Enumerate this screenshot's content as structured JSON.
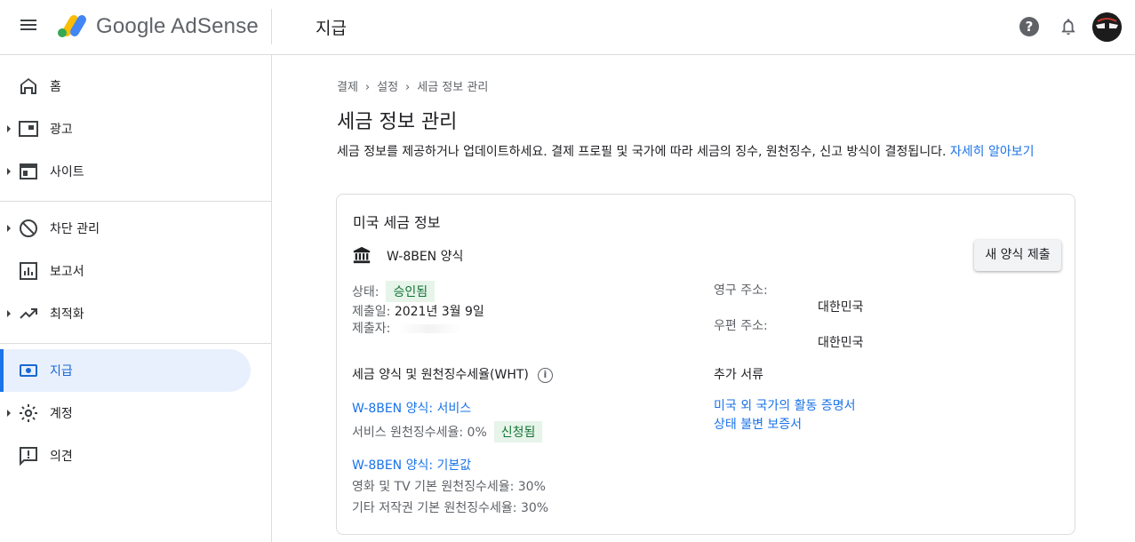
{
  "app": {
    "brand": "Google AdSense",
    "page_header": "지급"
  },
  "header": {
    "help_label": "?"
  },
  "sidebar": {
    "items": [
      {
        "label": "홈",
        "icon": "home-icon",
        "has_caret": false
      },
      {
        "label": "광고",
        "icon": "ads-icon",
        "has_caret": true
      },
      {
        "label": "사이트",
        "icon": "sites-icon",
        "has_caret": true
      },
      {
        "label": "차단 관리",
        "icon": "block-icon",
        "has_caret": true
      },
      {
        "label": "보고서",
        "icon": "reports-icon",
        "has_caret": false
      },
      {
        "label": "최적화",
        "icon": "trending-icon",
        "has_caret": true
      },
      {
        "label": "지급",
        "icon": "payments-icon",
        "has_caret": false,
        "active": true
      },
      {
        "label": "계정",
        "icon": "gear-icon",
        "has_caret": true
      },
      {
        "label": "의견",
        "icon": "feedback-icon",
        "has_caret": false
      }
    ]
  },
  "breadcrumb": {
    "items": [
      "결제",
      "설정",
      "세금 정보 관리"
    ],
    "separator": "›"
  },
  "main": {
    "title": "세금 정보 관리",
    "description": "세금 정보를 제공하거나 업데이트하세요. 결제 프로필 및 국가에 따라 세금의 징수, 원천징수, 신고 방식이 결정됩니다.",
    "learn_more": "자세히 알아보기"
  },
  "card": {
    "title": "미국 세금 정보",
    "form_name": "W-8BEN 양식",
    "new_form_button": "새 양식 제출",
    "status_label": "상태:",
    "status_value": "승인됨",
    "submitted_date_label": "제출일:",
    "submitted_date_value": "2021년 3월 9일",
    "submitted_by_label": "제출자:",
    "permanent_address_label": "영구 주소:",
    "permanent_address_value": "대한민국",
    "mailing_address_label": "우편 주소:",
    "mailing_address_value": "대한민국",
    "wht_heading": "세금 양식 및 원천징수세율(WHT)",
    "info_label": "i",
    "services_link": "W-8BEN 양식: 서비스",
    "services_rate": "서비스 원천징수세율: 0%",
    "services_badge": "신청됨",
    "default_link": "W-8BEN 양식: 기본값",
    "film_rate": "영화 및 TV 기본 원천징수세율: 30%",
    "other_rate": "기타 저작권 기본 원천징수세율: 30%",
    "additional_docs_heading": "추가 서류",
    "doc_link_1": "미국 외 국가의 활동 증명서",
    "doc_link_2": "상태 불변 보증서"
  },
  "colors": {
    "accent": "#1a73e8",
    "active_bg": "#e8f0fe",
    "badge_bg": "#e6f4ea",
    "badge_text": "#137333"
  }
}
